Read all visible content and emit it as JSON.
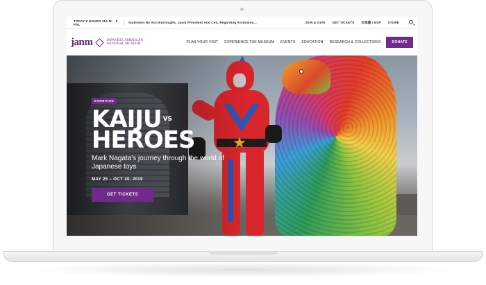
{
  "utility_bar": {
    "hours": "TODAY'S HOURS 11A.M. - 5 P.M.",
    "statement": "Statement By Ann Burroughs, Janm President And Ceo, Regarding Konmatsu...",
    "links": [
      "JOIN & GIVE",
      "GET TICKETS",
      "日本語 / ESP",
      "STORE"
    ],
    "search_icon": "search-icon"
  },
  "header": {
    "logo_word": "janm",
    "logo_line1": "JAPANESE AMERICAN",
    "logo_line2": "NATIONAL MUSEUM",
    "nav": [
      "PLAN YOUR VISIT",
      "EXPERIENCE THE MUSEUM",
      "EVENTS",
      "EDUCATION",
      "RESEARCH & COLLECTIONS"
    ],
    "donate_label": "DONATE"
  },
  "hero": {
    "eyebrow": "EXHIBITION",
    "title_line1": "KAIJU",
    "title_vs": "VS",
    "title_line2": "HEROES",
    "subtitle": "Mark Nagata's journey through the world of Japanese toys",
    "dates": "MAY 25 – OCT 20, 2019",
    "cta_label": "GET TICKETS"
  },
  "colors": {
    "brand_purple": "#6f2a8a",
    "logo_purple": "#5c2a6f"
  }
}
